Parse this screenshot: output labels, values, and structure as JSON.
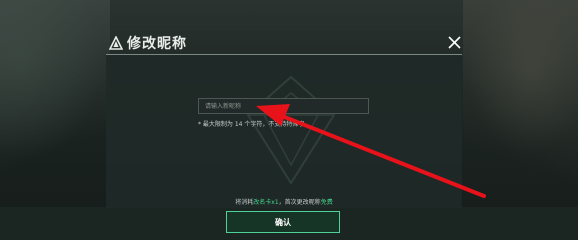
{
  "dialog": {
    "title": "修改昵称",
    "input_placeholder": "请输入新昵称",
    "hint": "* 最大限制为 14 个字符，不支持特殊字",
    "consume": {
      "prefix": "将消耗",
      "item": "改名卡x1",
      "middle": "，首次更改昵称",
      "free": "免费"
    },
    "confirm_label": "确认"
  },
  "colors": {
    "accent_green": "#47d28b",
    "arrow_red": "#e8121a"
  },
  "icons": {
    "title_icon": "warning-triangle-icon",
    "close": "close-icon"
  }
}
